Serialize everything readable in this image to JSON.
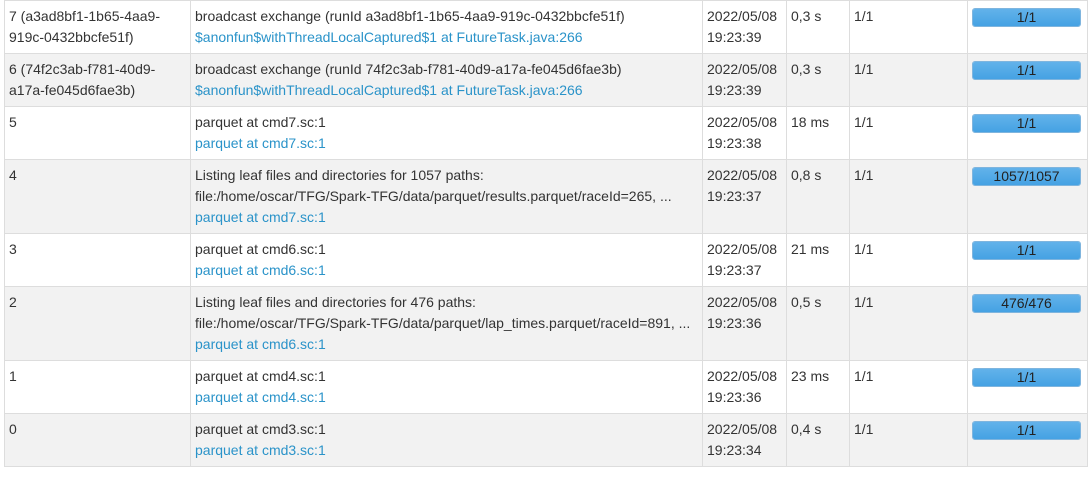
{
  "rows": [
    {
      "stage_id": "7 (a3ad8bf1-1b65-4aa9-919c-0432bbcfe51f)",
      "description": "broadcast exchange (runId a3ad8bf1-1b65-4aa9-919c-0432bbcfe51f)",
      "link": "$anonfun$withThreadLocalCaptured$1 at FutureTask.java:266",
      "submitted": "2022/05/08 19:23:39",
      "duration": "0,3 s",
      "tasks": "1/1",
      "progress_label": "1/1",
      "progress_fraction": 1
    },
    {
      "stage_id": "6 (74f2c3ab-f781-40d9-a17a-fe045d6fae3b)",
      "description": "broadcast exchange (runId 74f2c3ab-f781-40d9-a17a-fe045d6fae3b)",
      "link": "$anonfun$withThreadLocalCaptured$1 at FutureTask.java:266",
      "submitted": "2022/05/08 19:23:39",
      "duration": "0,3 s",
      "tasks": "1/1",
      "progress_label": "1/1",
      "progress_fraction": 1
    },
    {
      "stage_id": "5",
      "description": "parquet at cmd7.sc:1",
      "link": "parquet at cmd7.sc:1",
      "submitted": "2022/05/08 19:23:38",
      "duration": "18 ms",
      "tasks": "1/1",
      "progress_label": "1/1",
      "progress_fraction": 1
    },
    {
      "stage_id": "4",
      "description": "Listing leaf files and directories for 1057 paths:\nfile:/home/oscar/TFG/Spark-TFG/data/parquet/results.parquet/raceId=265, ...",
      "link": "parquet at cmd7.sc:1",
      "submitted": "2022/05/08 19:23:37",
      "duration": "0,8 s",
      "tasks": "1/1",
      "progress_label": "1057/1057",
      "progress_fraction": 1
    },
    {
      "stage_id": "3",
      "description": "parquet at cmd6.sc:1",
      "link": "parquet at cmd6.sc:1",
      "submitted": "2022/05/08 19:23:37",
      "duration": "21 ms",
      "tasks": "1/1",
      "progress_label": "1/1",
      "progress_fraction": 1
    },
    {
      "stage_id": "2",
      "description": "Listing leaf files and directories for 476 paths:\nfile:/home/oscar/TFG/Spark-TFG/data/parquet/lap_times.parquet/raceId=891, ...",
      "link": "parquet at cmd6.sc:1",
      "submitted": "2022/05/08 19:23:36",
      "duration": "0,5 s",
      "tasks": "1/1",
      "progress_label": "476/476",
      "progress_fraction": 1
    },
    {
      "stage_id": "1",
      "description": "parquet at cmd4.sc:1",
      "link": "parquet at cmd4.sc:1",
      "submitted": "2022/05/08 19:23:36",
      "duration": "23 ms",
      "tasks": "1/1",
      "progress_label": "1/1",
      "progress_fraction": 1
    },
    {
      "stage_id": "0",
      "description": "parquet at cmd3.sc:1",
      "link": "parquet at cmd3.sc:1",
      "submitted": "2022/05/08 19:23:34",
      "duration": "0,4 s",
      "tasks": "1/1",
      "progress_label": "1/1",
      "progress_fraction": 1
    }
  ]
}
